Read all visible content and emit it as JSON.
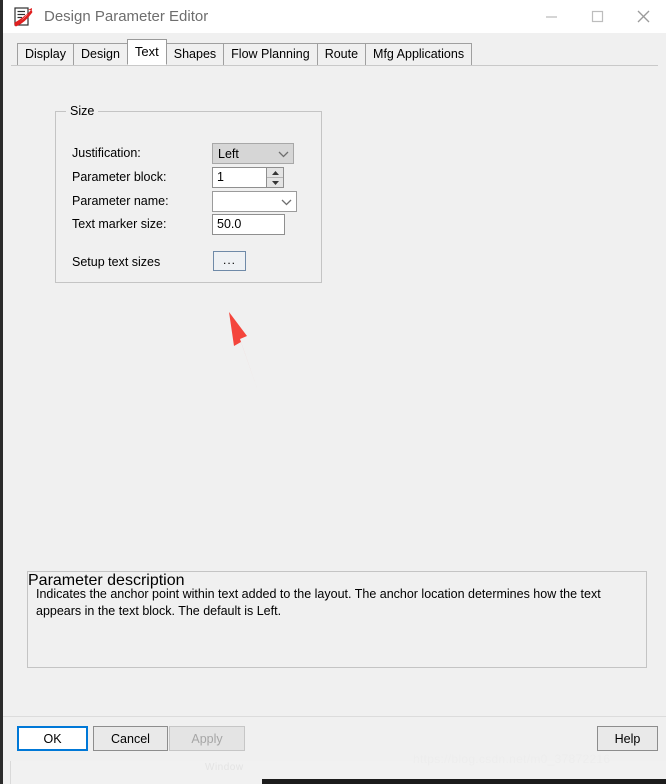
{
  "window": {
    "title": "Design Parameter Editor",
    "icon": "design-parameter-editor-icon",
    "controls": {
      "minimize": "minimize-icon",
      "maximize": "maximize-icon",
      "close": "close-icon"
    }
  },
  "tabs": [
    {
      "label": "Display",
      "selected": false
    },
    {
      "label": "Design",
      "selected": false
    },
    {
      "label": "Text",
      "selected": true
    },
    {
      "label": "Shapes",
      "selected": false
    },
    {
      "label": "Flow Planning",
      "selected": false
    },
    {
      "label": "Route",
      "selected": false
    },
    {
      "label": "Mfg Applications",
      "selected": false
    }
  ],
  "size_group": {
    "title": "Size",
    "justification": {
      "label": "Justification:",
      "value": "Left",
      "chevron": "chevron-down-icon"
    },
    "parameter_block": {
      "label": "Parameter block:",
      "value": "1",
      "spin_up": "spinner-up-icon",
      "spin_down": "spinner-down-icon"
    },
    "parameter_name": {
      "label": "Parameter name:",
      "value": "",
      "chevron": "chevron-down-icon"
    },
    "text_marker_size": {
      "label": "Text marker size:",
      "value": "50.0"
    },
    "setup_text_sizes": {
      "label": "Setup text sizes",
      "button_label": "..."
    }
  },
  "description_group": {
    "title": "Parameter description",
    "text": "Indicates the anchor point within text added to the layout. The anchor location determines how the text appears in the text block. The default is Left."
  },
  "buttons": {
    "ok": "OK",
    "cancel": "Cancel",
    "apply": "Apply",
    "help": "Help"
  },
  "annotation": {
    "arrow": "red-pointer-arrow",
    "color": "#f4453c"
  },
  "watermark": {
    "text": "https://blog.csdn.net/m0_37872216"
  },
  "underlay": {
    "faint_text": "Window"
  }
}
